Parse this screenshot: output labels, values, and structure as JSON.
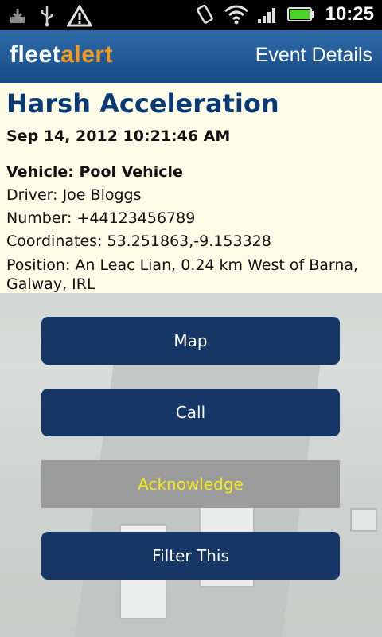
{
  "status_bar": {
    "time": "10:25",
    "icons": [
      "download-icon",
      "usb-icon",
      "warning-icon",
      "vibrate-icon",
      "wifi-icon",
      "signal-icon",
      "battery-icon"
    ]
  },
  "header": {
    "logo_part1": "fleet",
    "logo_part2": "alert",
    "title": "Event Details"
  },
  "event": {
    "title": "Harsh Acceleration",
    "datetime": "Sep 14, 2012 10:21:46 AM",
    "vehicle_label": "Vehicle: ",
    "vehicle": "Pool Vehicle",
    "driver": "Driver: Joe Bloggs",
    "number": "Number: +44123456789",
    "coordinates": "Coordinates: 53.251863,-9.153328",
    "position": "Position: An Leac Lian, 0.24 km West of Barna, Galway, IRL"
  },
  "actions": {
    "map": "Map",
    "call": "Call",
    "acknowledge": "Acknowledge",
    "filter": "Filter This"
  },
  "colors": {
    "header": "#1f5893",
    "logo_accent": "#f39a1f",
    "button": "#163766",
    "ack_button": "#9b9b9b",
    "ack_text": "#f2ea18",
    "info_bg": "#fffde8",
    "title_text": "#0a3a73"
  }
}
